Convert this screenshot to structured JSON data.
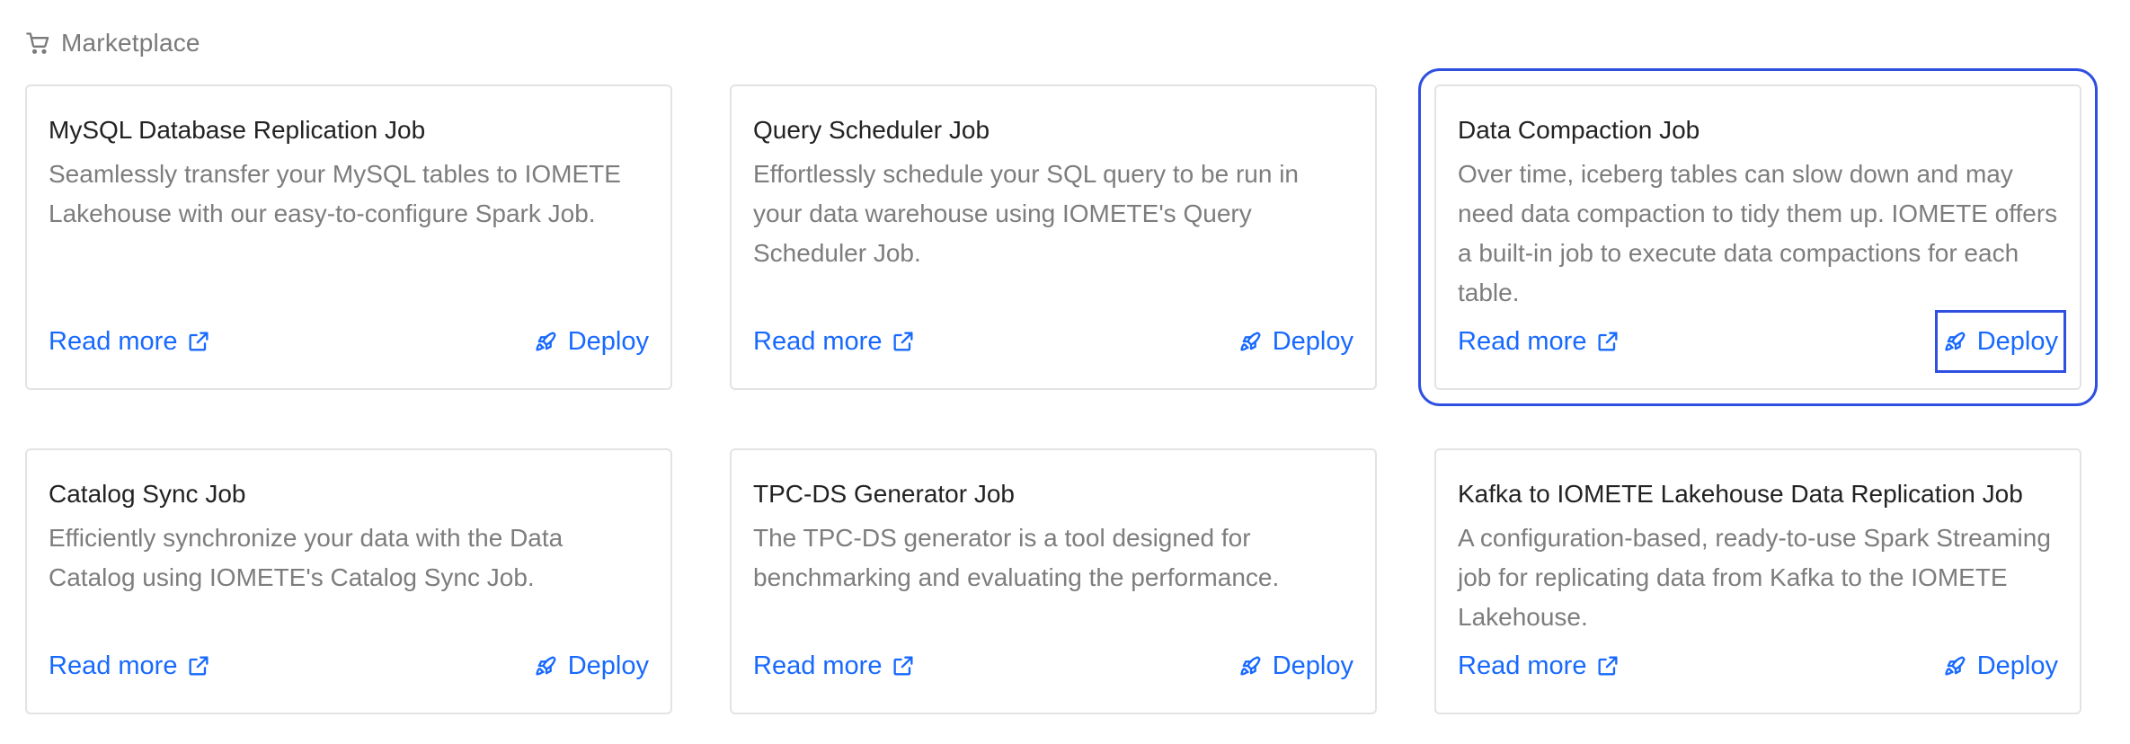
{
  "header": {
    "title": "Marketplace",
    "icon": "shopping-cart-icon"
  },
  "colors": {
    "accent": "#1769ff",
    "focus": "#2f4fe0",
    "border": "#e3e3e3",
    "muted_text": "#7d7d7d"
  },
  "cards": [
    {
      "title": "MySQL Database Replication Job",
      "description": "Seamlessly transfer your MySQL tables to IOMETE Lakehouse with our easy-to-configure Spark Job.",
      "read_more_label": "Read more",
      "deploy_label": "Deploy"
    },
    {
      "title": "Query Scheduler Job",
      "description": "Effortlessly schedule your SQL query to be run in your data warehouse using IOMETE's Query Scheduler Job.",
      "read_more_label": "Read more",
      "deploy_label": "Deploy"
    },
    {
      "title": "Data Compaction Job",
      "description": "Over time, iceberg tables can slow down and may need data compaction to tidy them up. IOMETE offers a built-in job to execute data compactions for each table.",
      "read_more_label": "Read more",
      "deploy_label": "Deploy"
    },
    {
      "title": "Catalog Sync Job",
      "description": "Efficiently synchronize your data with the Data Catalog using IOMETE's Catalog Sync Job.",
      "read_more_label": "Read more",
      "deploy_label": "Deploy"
    },
    {
      "title": "TPC-DS Generator Job",
      "description": "The TPC-DS generator is a tool designed for benchmarking and evaluating the performance.",
      "read_more_label": "Read more",
      "deploy_label": "Deploy"
    },
    {
      "title": "Kafka to IOMETE Lakehouse Data Replication Job",
      "description": "A configuration-based, ready-to-use Spark Streaming job for replicating data from Kafka to the IOMETE Lakehouse.",
      "read_more_label": "Read more",
      "deploy_label": "Deploy"
    }
  ]
}
